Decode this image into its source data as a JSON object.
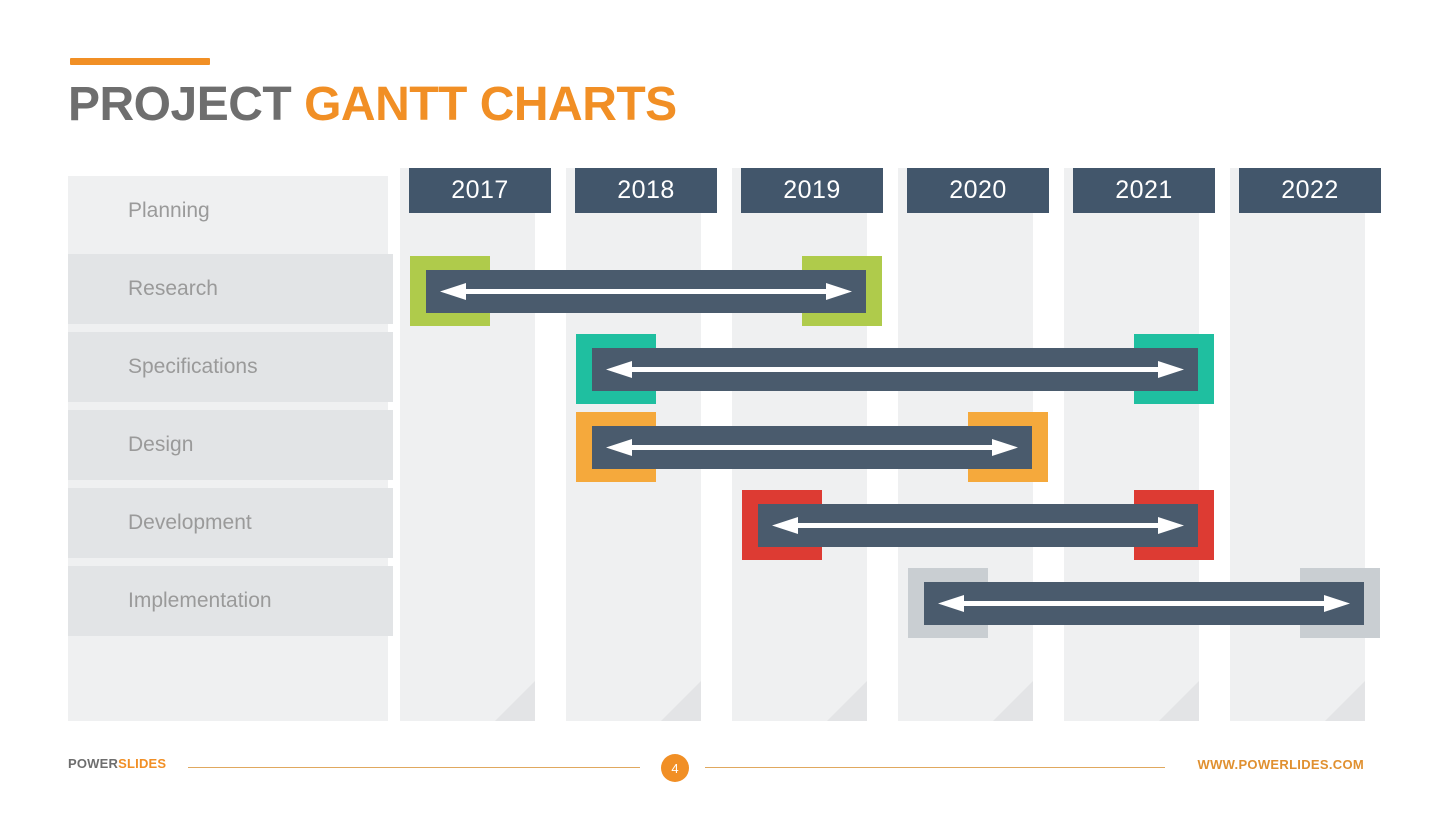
{
  "title": {
    "primary": "PROJECT",
    "accent": "GANTT CHARTS"
  },
  "colors": {
    "accent_orange": "#F18F25",
    "title_gray": "#6E6E6E",
    "bar_dark": "#4A5B6D",
    "header_dark": "#42566B",
    "panel_light": "#EFF0F1",
    "panel_alt": "#E2E4E6"
  },
  "tasks": [
    {
      "label": "Planning"
    },
    {
      "label": "Research"
    },
    {
      "label": "Specifications"
    },
    {
      "label": "Design"
    },
    {
      "label": "Development"
    },
    {
      "label": "Implementation"
    }
  ],
  "years": [
    {
      "label": "2017"
    },
    {
      "label": "2018"
    },
    {
      "label": "2019"
    },
    {
      "label": "2020"
    },
    {
      "label": "2021"
    },
    {
      "label": "2022"
    }
  ],
  "footer": {
    "brand_primary": "POWER",
    "brand_accent": "SLIDES",
    "page_number": "4",
    "url": "WWW.POWERLIDES.COM"
  },
  "chart_data": {
    "type": "bar",
    "title": "PROJECT GANTT CHARTS",
    "xlabel": "",
    "ylabel": "",
    "orientation": "horizontal",
    "categories": [
      "Planning",
      "Research",
      "Specifications",
      "Design",
      "Development",
      "Implementation"
    ],
    "x_ticks": [
      "2017",
      "2018",
      "2019",
      "2020",
      "2021",
      "2022"
    ],
    "xlim": [
      "2017",
      "2022"
    ],
    "grid": false,
    "legend": "none",
    "bars": [
      {
        "task": "Research",
        "start": "2017",
        "end": "2019",
        "color": "#AFCB4B",
        "arrow": "double"
      },
      {
        "task": "Specifications",
        "start": "2018",
        "end": "2021",
        "color": "#1FBFA0",
        "arrow": "double"
      },
      {
        "task": "Design",
        "start": "2018",
        "end": "2020",
        "color": "#F5A93C",
        "arrow": "double"
      },
      {
        "task": "Development",
        "start": "2019",
        "end": "2021",
        "color": "#DD3B33",
        "arrow": "double"
      },
      {
        "task": "Implementation",
        "start": "2020",
        "end": "2022",
        "color": "#C9CED2",
        "arrow": "double"
      }
    ]
  }
}
